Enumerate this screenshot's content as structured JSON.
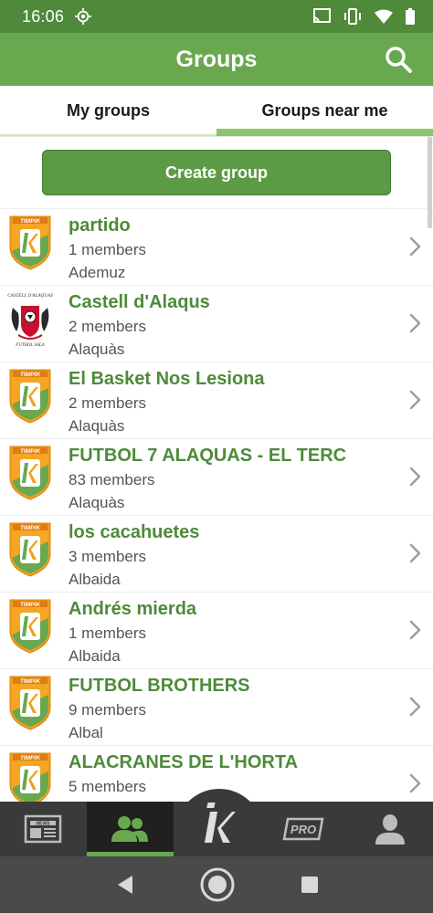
{
  "status_bar": {
    "time": "16:06"
  },
  "app_bar": {
    "title": "Groups"
  },
  "tabs": [
    {
      "label": "My groups",
      "active": false
    },
    {
      "label": "Groups near me",
      "active": true
    }
  ],
  "create_button": {
    "label": "Create group"
  },
  "groups": [
    {
      "name": "partido",
      "members": "1 members",
      "place": "Ademuz",
      "logo": "timpik-shield"
    },
    {
      "name": "Castell d'Alaqus",
      "members": "2 members",
      "place": "Alaquàs",
      "logo": "castell-dalaquas-crest",
      "logo_text_top": "CASTELL D'ALAQUAS",
      "logo_text_bottom": "FUTBOL SALA"
    },
    {
      "name": "El Basket Nos Lesiona",
      "members": "2 members",
      "place": "Alaquàs",
      "logo": "timpik-shield"
    },
    {
      "name": "FUTBOL 7 ALAQUAS - EL TERC",
      "members": "83 members",
      "place": "Alaquàs",
      "logo": "timpik-shield"
    },
    {
      "name": "los cacahuetes",
      "members": "3 members",
      "place": "Albaida",
      "logo": "timpik-shield"
    },
    {
      "name": "Andrés mierda",
      "members": "1 members",
      "place": "Albaida",
      "logo": "timpik-shield"
    },
    {
      "name": "FUTBOL BROTHERS",
      "members": "9 members",
      "place": "Albal",
      "logo": "timpik-shield"
    },
    {
      "name": "ALACRANES DE L'HORTA",
      "members": "5 members",
      "place": "",
      "logo": "timpik-shield"
    }
  ],
  "shield_text": "TIMPIK",
  "bottom_nav": [
    {
      "name": "news",
      "icon": "newspaper-icon",
      "label": "NEWS"
    },
    {
      "name": "groups",
      "icon": "group-icon",
      "active": true
    },
    {
      "name": "home",
      "icon": "timpik-logo-icon"
    },
    {
      "name": "pro",
      "icon": "pro-icon",
      "label": "PRO"
    },
    {
      "name": "profile",
      "icon": "person-icon"
    }
  ],
  "colors": {
    "accent": "#6aa84f",
    "status_bar": "#4e8a3a",
    "name_text": "#4e8a3a"
  }
}
